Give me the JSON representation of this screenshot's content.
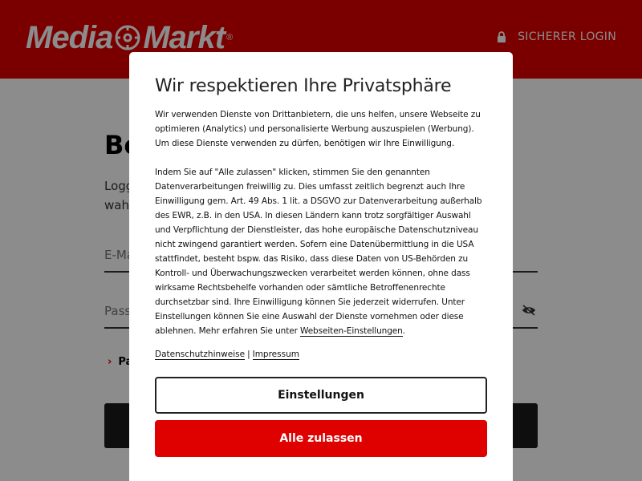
{
  "header": {
    "logo_text_left": "Media",
    "logo_text_right": "Markt",
    "logo_reg": "®",
    "secure_login_label": "SICHERER LOGIN"
  },
  "page": {
    "title_partial": "Be",
    "intro_line1_partial": "Logg",
    "intro_line2_partial": "wahr",
    "email_placeholder": "E-Ma",
    "password_placeholder": "Pass",
    "forgot_link_partial": "Pa"
  },
  "modal": {
    "title": "Wir respektieren Ihre Privatsphäre",
    "paragraph1": "Wir verwenden Dienste von Drittanbietern, die uns helfen, unsere Webseite zu optimieren (Analytics) und personalisierte Werbung auszuspielen (Werbung). Um diese Dienste verwenden zu dürfen, benötigen wir Ihre Einwilligung.",
    "paragraph2": "Indem Sie auf \"Alle zulassen\" klicken, stimmen Sie den genannten Datenverarbeitungen freiwillig zu. Dies umfasst zeitlich begrenzt auch Ihre Einwilligung gem. Art. 49 Abs. 1 lit. a DSGVO zur Datenverarbeitung außerhalb des EWR, z.B. in den USA. In diesen Ländern kann trotz sorgfältiger Auswahl und Verpflichtung der Dienstleister, das hohe europäische Datenschutzniveau nicht zwingend garantiert werden. Sofern eine Datenübermittlung in die USA stattfindet, besteht bspw. das Risiko, dass diese Daten von US-Behörden zu Kontroll- und Überwachungszwecken verarbeitet werden können, ohne dass wirksame Rechtsbehelfe vorhanden oder sämtliche Betroffenenrechte durchsetzbar sind. Ihre Einwilligung können Sie jederzeit widerrufen. Unter Einstellungen können Sie eine Auswahl der Dienste vornehmen oder diese ablehnen. Mehr erfahren Sie unter ",
    "paragraph2_link": "Webseiten-Einstellungen",
    "paragraph2_end": ".",
    "privacy_link": "Datenschutzhinweise",
    "separator": "|",
    "imprint_link": "Impressum",
    "settings_button": "Einstellungen",
    "accept_button": "Alle zulassen"
  },
  "colors": {
    "brand_red": "#df0000",
    "dark_button": "#1a1a1a"
  }
}
